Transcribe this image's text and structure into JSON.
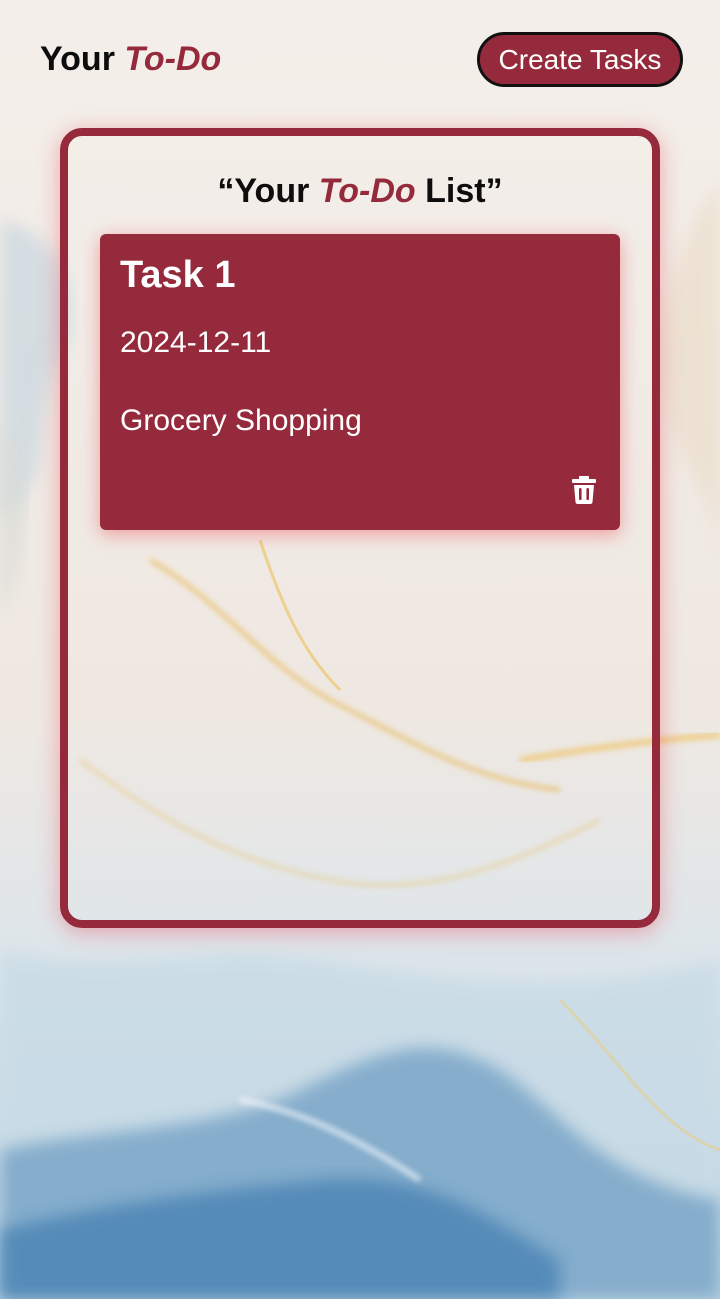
{
  "header": {
    "brand_prefix": "Your",
    "brand_accent": "To-Do",
    "create_button_label": "Create Tasks"
  },
  "list": {
    "title_open": "“Your",
    "title_accent": "To-Do",
    "title_close": "List”"
  },
  "tasks": [
    {
      "title": "Task 1",
      "date": "2024-12-11",
      "description": "Grocery Shopping",
      "delete_icon": "trash-icon"
    }
  ],
  "colors": {
    "accent": "#942a3b",
    "text_dark": "#0d0d0d",
    "card_text": "#ffffff"
  }
}
